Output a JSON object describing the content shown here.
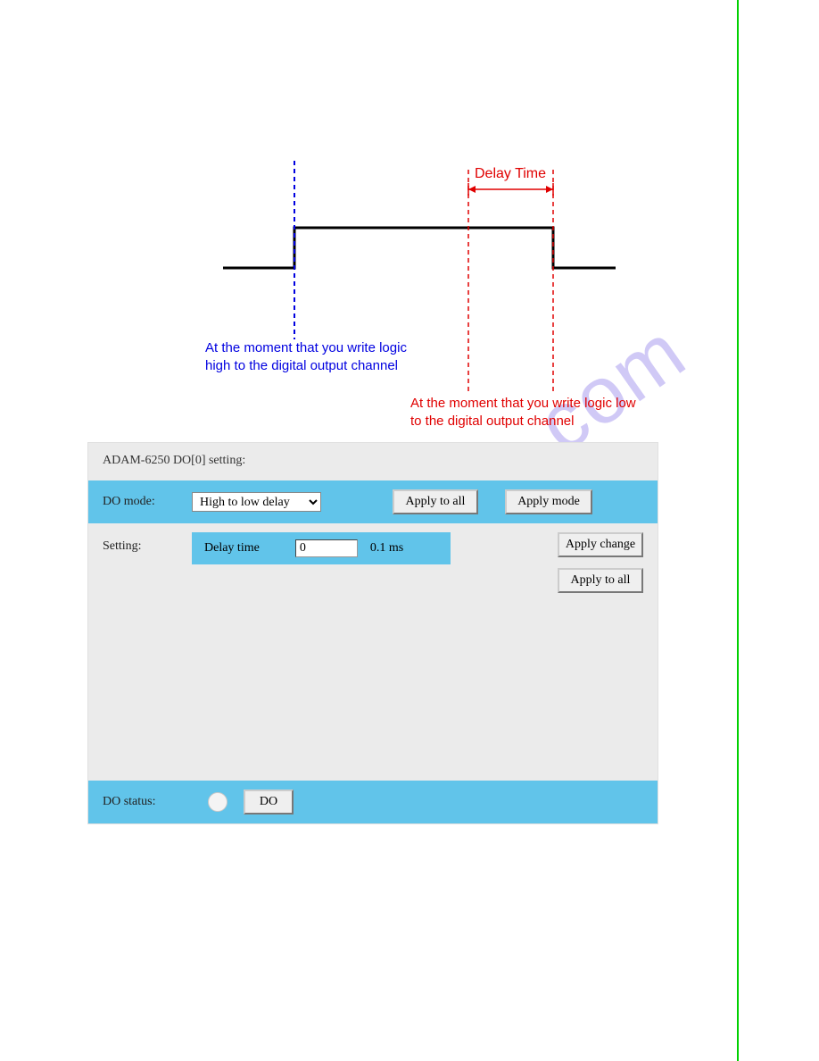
{
  "watermark": "manualshive.com",
  "diagram": {
    "delay_time_label": "Delay Time",
    "blue_note_line1": "At the moment that you write logic",
    "blue_note_line2": "high to the digital output channel",
    "red_note_line1": "At the moment that  you write logic low",
    "red_note_line2": "to the digital output channel"
  },
  "panel": {
    "title": "ADAM-6250 DO[0] setting:",
    "do_mode_label": "DO mode:",
    "do_mode_value": "High to low delay",
    "apply_to_all_1": "Apply to all",
    "apply_mode": "Apply mode",
    "setting_label": "Setting:",
    "delay_time_label": "Delay time",
    "delay_time_value": "0",
    "delay_time_unit": "0.1 ms",
    "apply_change": "Apply change",
    "apply_to_all_2": "Apply to all",
    "do_status_label": "DO status:",
    "do_button": "DO"
  }
}
